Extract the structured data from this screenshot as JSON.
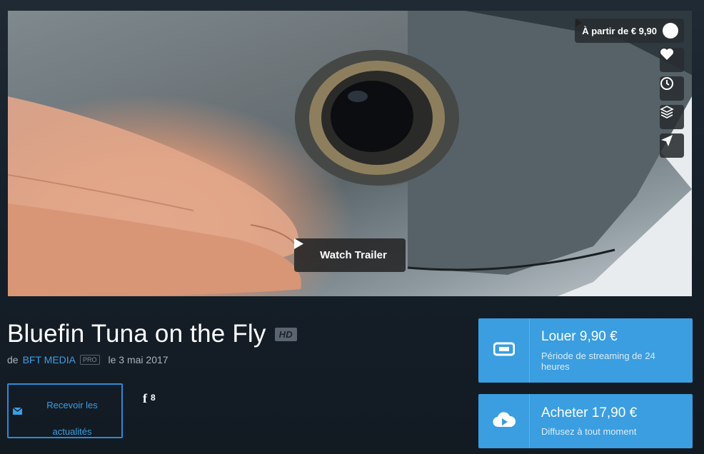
{
  "hero": {
    "price_pill": "À partir de € 9,90",
    "watch_trailer": "Watch Trailer",
    "side_buttons": [
      "heart-icon",
      "clock-icon",
      "layers-icon",
      "send-icon"
    ]
  },
  "film": {
    "title": "Bluefin Tuna on the Fly",
    "hd_badge": "HD",
    "by_prefix": "de",
    "publisher": "BFT MEDIA",
    "publisher_badge": "PRO",
    "date": "le 3 mai 2017"
  },
  "actions": {
    "follow_label": "Recevoir les actualités",
    "facebook_letter": "f",
    "facebook_count": "8"
  },
  "offers": {
    "rent": {
      "title": "Louer 9,90 €",
      "subtitle": "Période de streaming de 24 heures"
    },
    "buy": {
      "title": "Acheter 17,90 €",
      "subtitle": "Diffusez à tout moment"
    }
  },
  "colors": {
    "accent": "#3a9ee0",
    "link": "#3aa0e6",
    "background": "#16202a"
  }
}
